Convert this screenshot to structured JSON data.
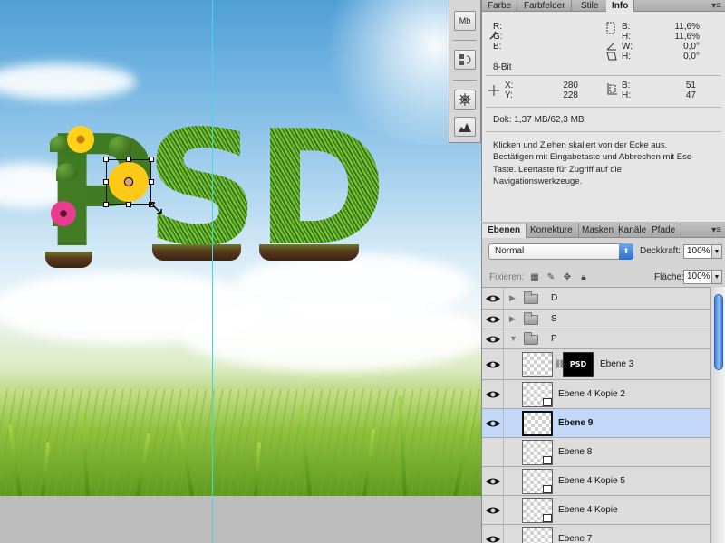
{
  "canvas": {
    "letters": [
      "P",
      "S",
      "D"
    ]
  },
  "dock": {
    "buttons": [
      {
        "icon": "minibridge-icon",
        "label": "Mb"
      },
      {
        "icon": "history-icon",
        "label": ""
      },
      {
        "icon": "navigator-icon",
        "label": ""
      },
      {
        "icon": "histogram-icon",
        "label": ""
      }
    ]
  },
  "info_panel": {
    "tabs": [
      "Farbe",
      "Farbfelder",
      "Stile",
      "Info"
    ],
    "active_tab": "Info",
    "rgb": {
      "r_label": "R:",
      "g_label": "G:",
      "b_label": "B:",
      "r": "",
      "g": "",
      "b": ""
    },
    "bits": "8-Bit",
    "hwb": {
      "b_label": "B:",
      "h_label": "H:",
      "b": "11,6%",
      "h": "11,6%"
    },
    "angles": {
      "w_label": "W:",
      "h_label": "H:",
      "w": "0,0°",
      "h": "0,0°"
    },
    "position": {
      "x_label": "X:",
      "y_label": "Y:",
      "x": "280",
      "y": "228"
    },
    "size": {
      "b_label": "B:",
      "h_label": "H:",
      "b": "51",
      "h": "47"
    },
    "doc": "Dok: 1,37 MB/62,3 MB",
    "help_lines": [
      "Klicken und Ziehen skaliert von der Ecke aus.",
      "Bestätigen mit Eingabetaste und Abbrechen mit Esc-",
      "Taste. Leertaste für Zugriff auf die",
      "Navigationswerkzeuge."
    ]
  },
  "layers_panel": {
    "tabs": [
      "Ebenen",
      "Korrekture",
      "Masken",
      "Kanäle",
      "Pfade"
    ],
    "active_tab": "Ebenen",
    "blend_mode": "Normal",
    "opacity_label": "Deckkraft:",
    "opacity": "100%",
    "lock_label": "Fixieren:",
    "fill_label": "Fläche:",
    "fill": "100%",
    "layers": [
      {
        "name": "D",
        "type": "group",
        "expanded": false,
        "visible": true,
        "selected": false
      },
      {
        "name": "S",
        "type": "group",
        "expanded": false,
        "visible": true,
        "selected": false
      },
      {
        "name": "P",
        "type": "group",
        "expanded": true,
        "visible": true,
        "selected": false
      },
      {
        "name": "Ebene 3",
        "type": "masked",
        "mask_text": "PSD",
        "visible": true,
        "selected": false
      },
      {
        "name": "Ebene 4 Kopie 2",
        "type": "smart",
        "visible": true,
        "selected": false
      },
      {
        "name": "Ebene 9",
        "type": "layer",
        "visible": true,
        "selected": true
      },
      {
        "name": "Ebene 8",
        "type": "smart",
        "visible": true,
        "selected": false
      },
      {
        "name": "Ebene 4 Kopie 5",
        "type": "smart",
        "visible": true,
        "selected": false
      },
      {
        "name": "Ebene 4 Kopie",
        "type": "smart",
        "visible": true,
        "selected": false
      },
      {
        "name": "Ebene 7",
        "type": "smart",
        "visible": true,
        "selected": false
      }
    ]
  },
  "colors": {
    "selection_highlight": "#c2d8f9",
    "guide": "#3fd6e6",
    "scroll_thumb": "#3b7fe0"
  }
}
